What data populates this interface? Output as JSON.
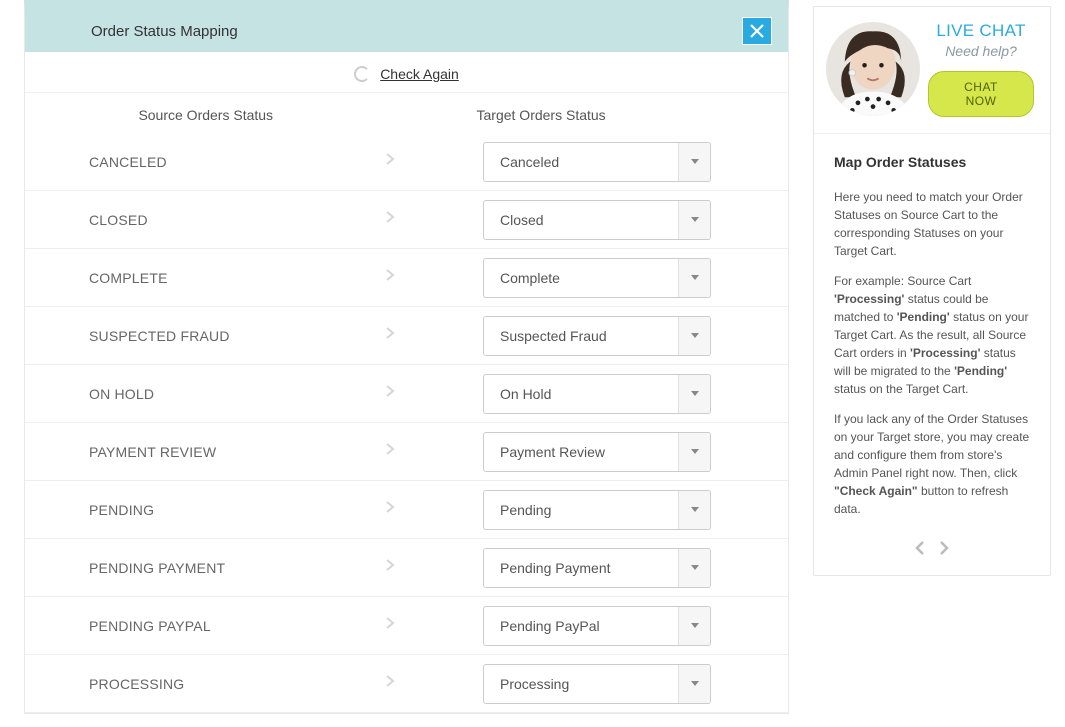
{
  "panel": {
    "title": "Order Status Mapping",
    "check_again": "Check Again",
    "source_header": "Source Orders Status",
    "target_header": "Target Orders Status"
  },
  "mappings": [
    {
      "source": "CANCELED",
      "target": "Canceled"
    },
    {
      "source": "CLOSED",
      "target": "Closed"
    },
    {
      "source": "COMPLETE",
      "target": "Complete"
    },
    {
      "source": "SUSPECTED FRAUD",
      "target": "Suspected Fraud"
    },
    {
      "source": "ON HOLD",
      "target": "On Hold"
    },
    {
      "source": "PAYMENT REVIEW",
      "target": "Payment Review"
    },
    {
      "source": "PENDING",
      "target": "Pending"
    },
    {
      "source": "PENDING PAYMENT",
      "target": "Pending Payment"
    },
    {
      "source": "PENDING PAYPAL",
      "target": "Pending PayPal"
    },
    {
      "source": "PROCESSING",
      "target": "Processing"
    }
  ],
  "chat": {
    "title": "LIVE CHAT",
    "subtitle": "Need help?",
    "button": "CHAT NOW"
  },
  "help": {
    "title": "Map Order Statuses",
    "p1": "Here you need to match your Order Statuses on Source Cart to the corresponding Statuses on your Target Cart.",
    "p2_a": "For example: Source Cart ",
    "p2_b": "'Processing'",
    "p2_c": " status could be matched to ",
    "p2_d": "'Pending'",
    "p2_e": " status on your Target Cart. As the result, all Source Cart orders in ",
    "p2_f": "'Processing'",
    "p2_g": " status will be migrated to the ",
    "p2_h": "'Pending'",
    "p2_i": " status on the Target Cart.",
    "p3_a": "If you lack any of the Order Statuses on your Target store, you may create and configure them from store's Admin Panel right now. Then, click ",
    "p3_b": "\"Check Again\"",
    "p3_c": " button to refresh data."
  }
}
